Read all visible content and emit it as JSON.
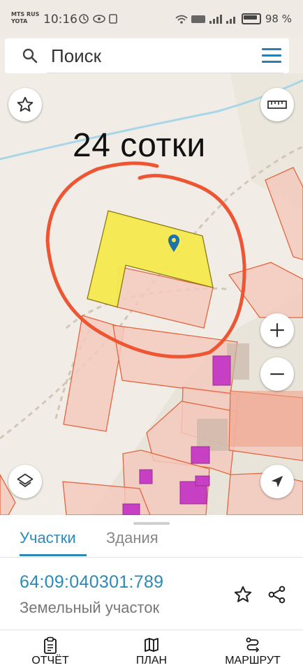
{
  "status_bar": {
    "carrier_line1": "MTS RUS",
    "carrier_line2": "YOTA",
    "time": "10:16",
    "battery": "98 %"
  },
  "search": {
    "placeholder": "Поиск"
  },
  "map": {
    "annotation": "24 сотки",
    "colors": {
      "selected_parcel": "#f5e94e",
      "parcel_fill": "#f3c9bd",
      "parcel_stroke": "#e2663f",
      "building": "#c73fc2",
      "circle": "#ee5533"
    }
  },
  "sheet": {
    "tabs": [
      {
        "label": "Участки",
        "active": true
      },
      {
        "label": "Здания",
        "active": false
      }
    ],
    "cadastral_number": "64:09:040301:789",
    "object_type": "Земельный участок"
  },
  "bottom_nav": [
    {
      "label": "ОТЧЁТ",
      "icon": "clipboard-icon"
    },
    {
      "label": "ПЛАН",
      "icon": "map-icon"
    },
    {
      "label": "МАРШРУТ",
      "icon": "route-icon"
    }
  ]
}
